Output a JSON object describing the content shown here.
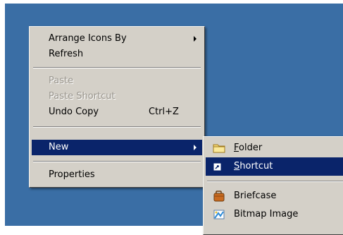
{
  "context_menu": {
    "items": [
      {
        "label": "Arrange Icons By",
        "has_submenu": true,
        "disabled": false
      },
      {
        "label": "Refresh",
        "disabled": false
      },
      {
        "label": "Paste",
        "disabled": true
      },
      {
        "label": "Paste Shortcut",
        "disabled": true
      },
      {
        "label": "Undo Copy",
        "shortcut": "Ctrl+Z",
        "disabled": false
      },
      {
        "label": "New",
        "has_submenu": true,
        "selected": true
      },
      {
        "label": "Properties",
        "disabled": false
      }
    ]
  },
  "new_submenu": {
    "items": [
      {
        "accel": "F",
        "rest": "older",
        "icon": "folder-icon"
      },
      {
        "accel": "S",
        "rest": "hortcut",
        "icon": "shortcut-icon",
        "selected": true
      },
      {
        "label": "Briefcase",
        "icon": "briefcase-icon"
      },
      {
        "label": "Bitmap Image",
        "icon": "bitmap-image-icon"
      }
    ]
  },
  "colors": {
    "desktop": "#3a6ea5",
    "menu_face": "#d4d0c8",
    "highlight": "#0a246a",
    "highlight_text": "#ffffff",
    "disabled_text": "#9a968e"
  }
}
